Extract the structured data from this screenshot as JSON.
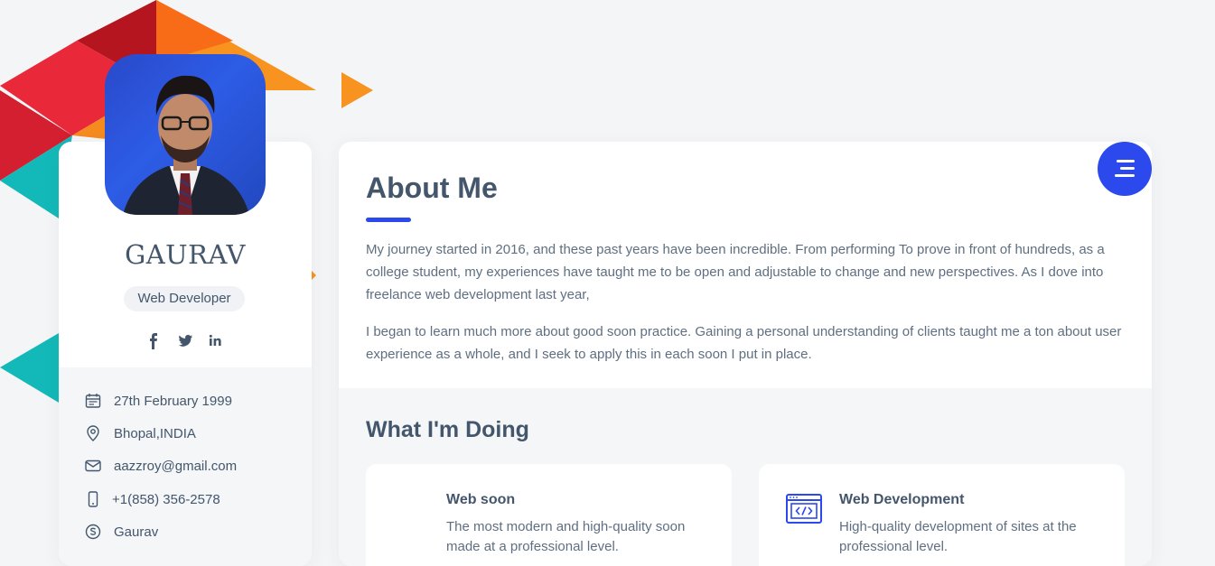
{
  "profile": {
    "name": "GAURAV",
    "role": "Web Developer",
    "socials": [
      "facebook-icon",
      "twitter-icon",
      "linkedin-icon"
    ],
    "info": [
      {
        "icon": "calendar-icon",
        "text": "27th February 1999"
      },
      {
        "icon": "location-icon",
        "text": "Bhopal,INDIA"
      },
      {
        "icon": "mail-icon",
        "text": "aazzroy@gmail.com"
      },
      {
        "icon": "phone-icon",
        "text": "+1(858) 356-2578"
      },
      {
        "icon": "skype-icon",
        "text": "Gaurav"
      }
    ]
  },
  "about": {
    "title": "About Me",
    "paragraphs": [
      "My journey started in 2016, and these past years have been incredible. From performing To prove in front of hundreds, as a college student, my experiences have taught me to be open and adjustable to change and new perspectives. As I dove into freelance web development last year,",
      "I began to learn much more about good soon practice. Gaining a personal understanding of clients taught me a ton about user experience as a whole, and I seek to apply this in each soon I put in place."
    ]
  },
  "doing": {
    "title": "What I'm Doing",
    "services": [
      {
        "title": "Web soon",
        "desc": "The most modern and high-quality soon made at a professional level."
      },
      {
        "title": "Web Development",
        "desc": "High-quality development of sites at the professional level.",
        "icon": "code-window-icon"
      }
    ]
  },
  "colors": {
    "accent": "#2c49ee",
    "text": "#44566c",
    "orange": "#f7931e",
    "red": "#e9283a",
    "teal": "#13b9b8"
  }
}
